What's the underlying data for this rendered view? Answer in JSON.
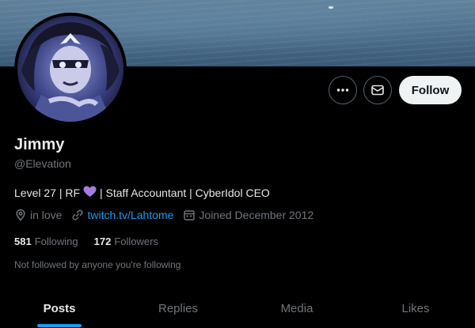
{
  "banner": {
    "description_icon": "water-banner"
  },
  "profile": {
    "name": "Jimmy",
    "handle": "@Elevation",
    "bio_prefix": "Level 27 | RF",
    "bio_heart": "💜",
    "bio_suffix": "| Staff Accountant | CyberIdol CEO",
    "location": "in love",
    "link": "twitch.tv/Lahtome",
    "joined": "Joined December 2012"
  },
  "actions": {
    "more_icon": "more-icon",
    "message_icon": "mail-icon",
    "follow_label": "Follow"
  },
  "stats": {
    "following_count": "581",
    "following_label": "Following",
    "followers_count": "172",
    "followers_label": "Followers"
  },
  "followed_note": "Not followed by anyone you're following",
  "tabs": [
    {
      "label": "Posts",
      "active": true
    },
    {
      "label": "Replies",
      "active": false
    },
    {
      "label": "Media",
      "active": false
    },
    {
      "label": "Likes",
      "active": false
    }
  ],
  "colors": {
    "accent": "#1d9bf0",
    "heart": "#a57be0",
    "muted": "#71767b"
  }
}
